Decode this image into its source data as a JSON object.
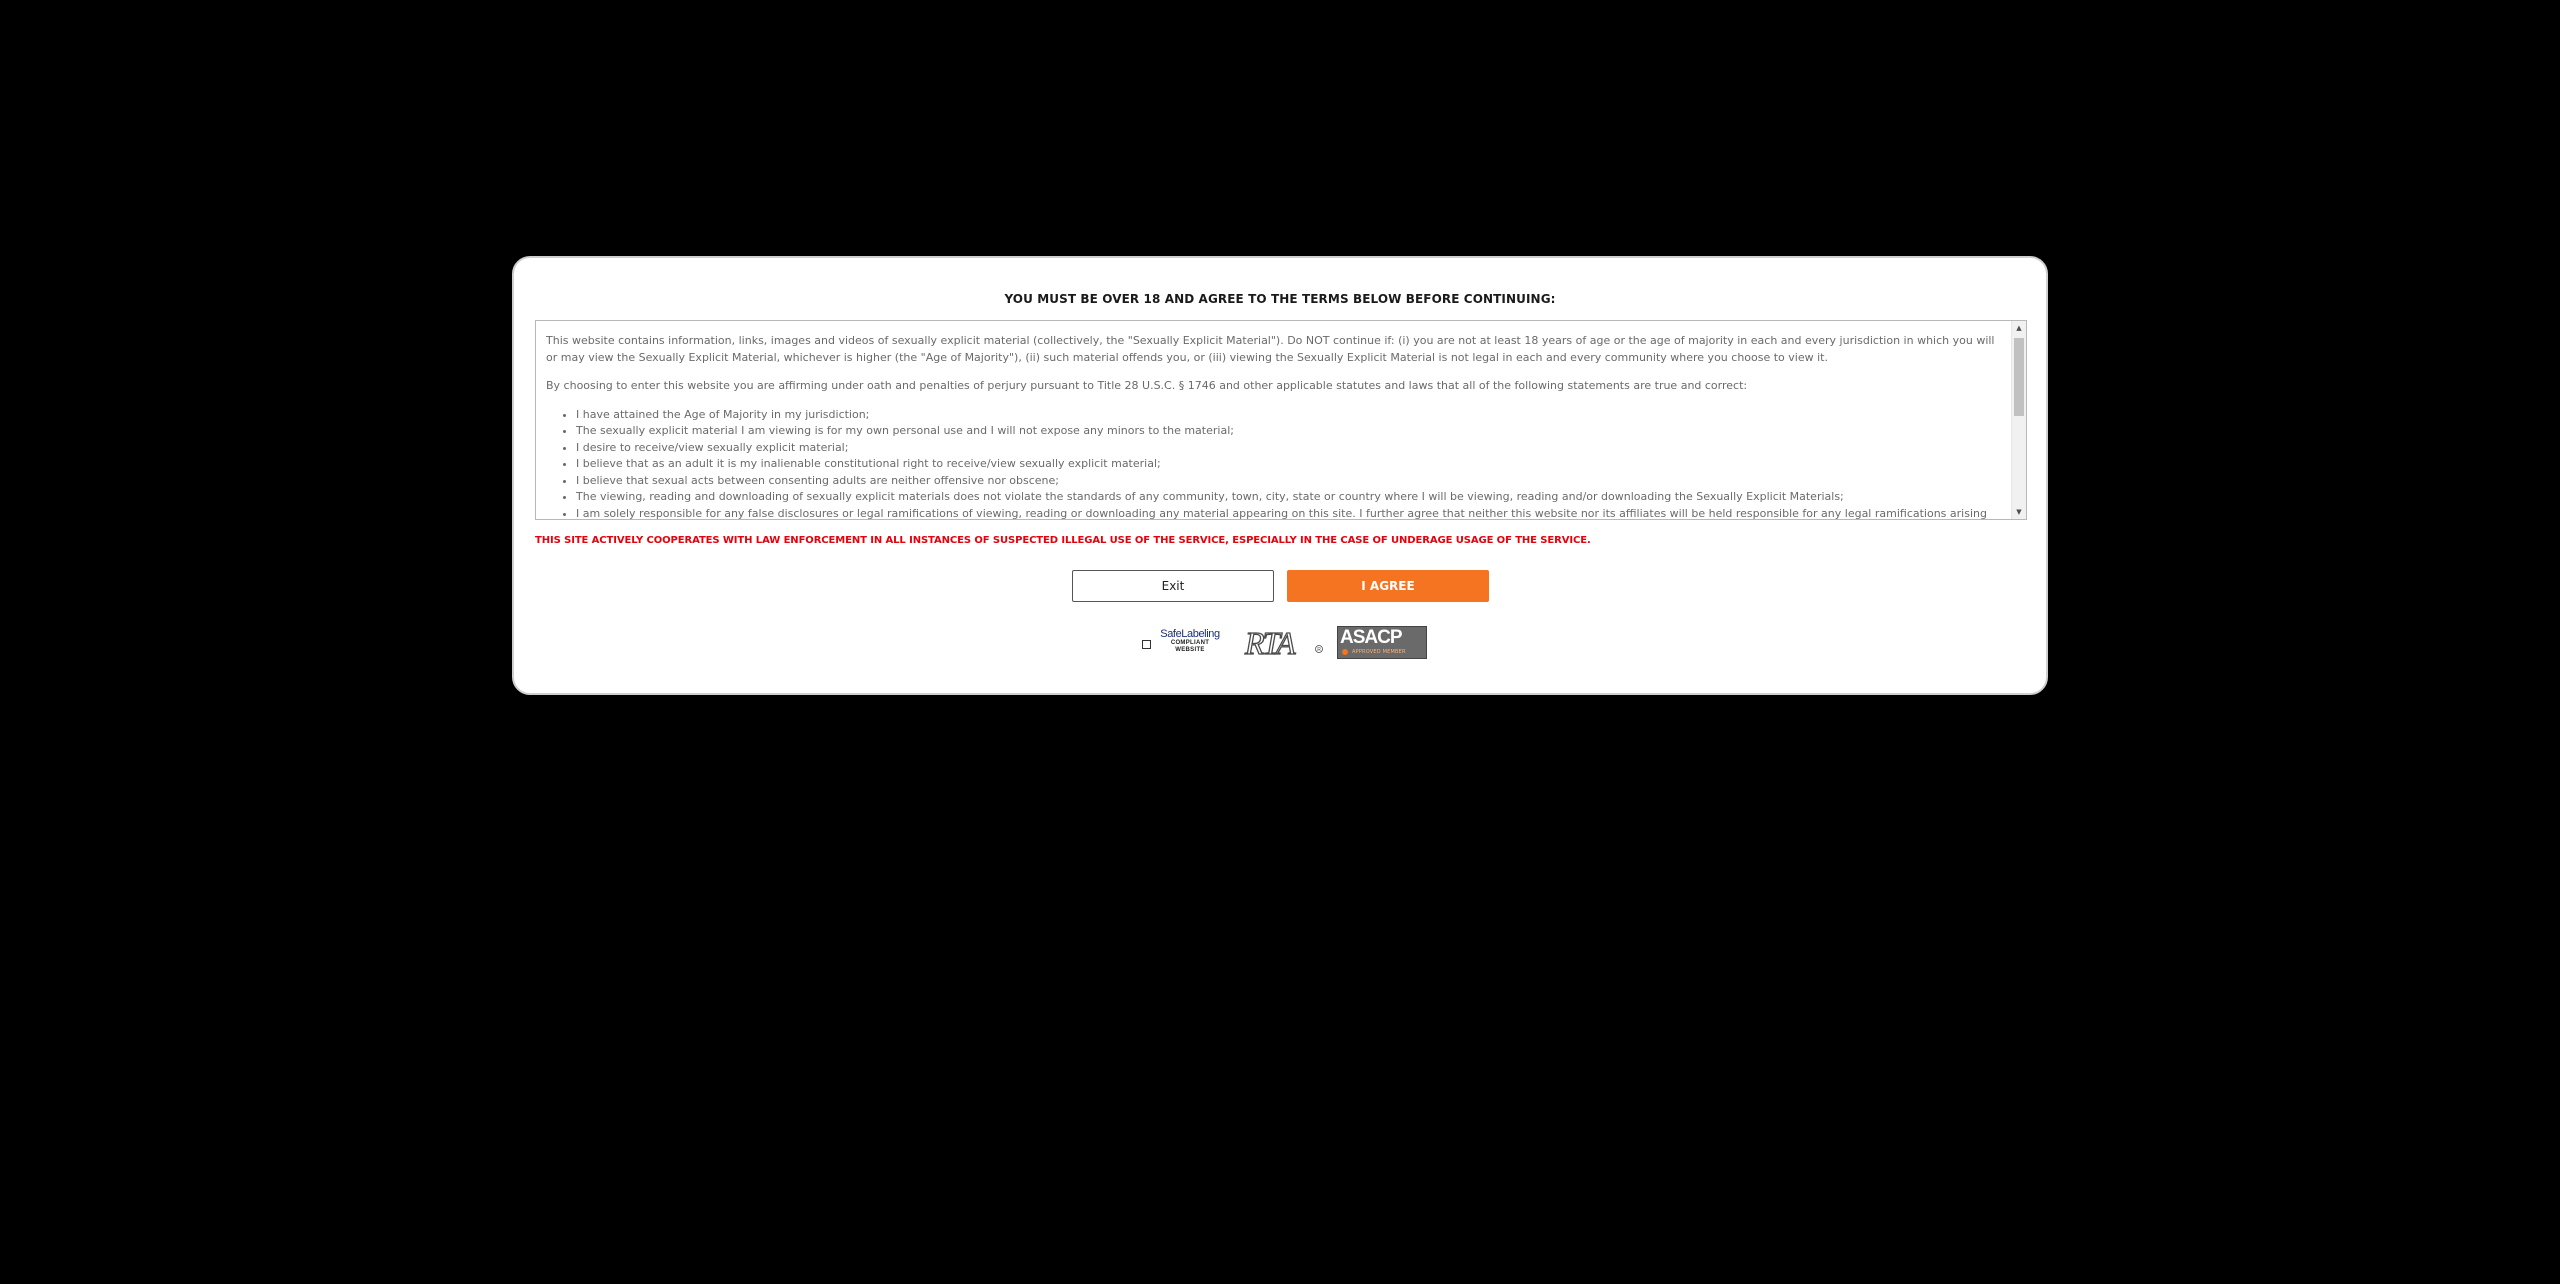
{
  "modal": {
    "title": "YOU MUST BE OVER 18 AND AGREE TO THE TERMS BELOW BEFORE CONTINUING:",
    "paragraphs": [
      "This website contains information, links, images and videos of sexually explicit material (collectively, the \"Sexually Explicit Material\"). Do NOT continue if: (i) you are not at least 18 years of age or the age of majority in each and every jurisdiction in which you will or may view the Sexually Explicit Material, whichever is higher (the \"Age of Majority\"), (ii) such material offends you, or (iii) viewing the Sexually Explicit Material is not legal in each and every community where you choose to view it.",
      "By choosing to enter this website you are affirming under oath and penalties of perjury pursuant to Title 28 U.S.C. § 1746 and other applicable statutes and laws that all of the following statements are true and correct:"
    ],
    "list_items": [
      "I have attained the Age of Majority in my jurisdiction;",
      "The sexually explicit material I am viewing is for my own personal use and I will not expose any minors to the material;",
      "I desire to receive/view sexually explicit material;",
      "I believe that as an adult it is my inalienable constitutional right to receive/view sexually explicit material;",
      "I believe that sexual acts between consenting adults are neither offensive nor obscene;",
      "The viewing, reading and downloading of sexually explicit materials does not violate the standards of any community, town, city, state or country where I will be viewing, reading and/or downloading the Sexually Explicit Materials;",
      "I am solely responsible for any false disclosures or legal ramifications of viewing, reading or downloading any material appearing on this site. I further agree that neither this website nor its affiliates will be held responsible for any legal ramifications arising"
    ],
    "warning": "THIS SITE ACTIVELY COOPERATES WITH LAW ENFORCEMENT IN ALL INSTANCES OF SUSPECTED ILLEGAL USE OF THE SERVICE, ESPECIALLY IN THE CASE OF UNDERAGE USAGE OF THE SERVICE.",
    "exit_label": "Exit",
    "agree_label": "I AGREE"
  },
  "badges": {
    "safelabeling": "SafeLabeling",
    "safelabeling_sub1": "COMPLIANT",
    "safelabeling_sub2": "WEBSITE",
    "rta": "RTA",
    "asacp": "ASACP",
    "asacp_sub": "APPROVED MEMBER"
  },
  "colors": {
    "background": "#000000",
    "modal": "#ffffff",
    "accent": "#f47421",
    "warning": "#e8000b"
  },
  "icons": {
    "scroll_up": "triangle-up-icon",
    "scroll_down": "triangle-down-icon",
    "checkbox": "checkbox-icon"
  }
}
